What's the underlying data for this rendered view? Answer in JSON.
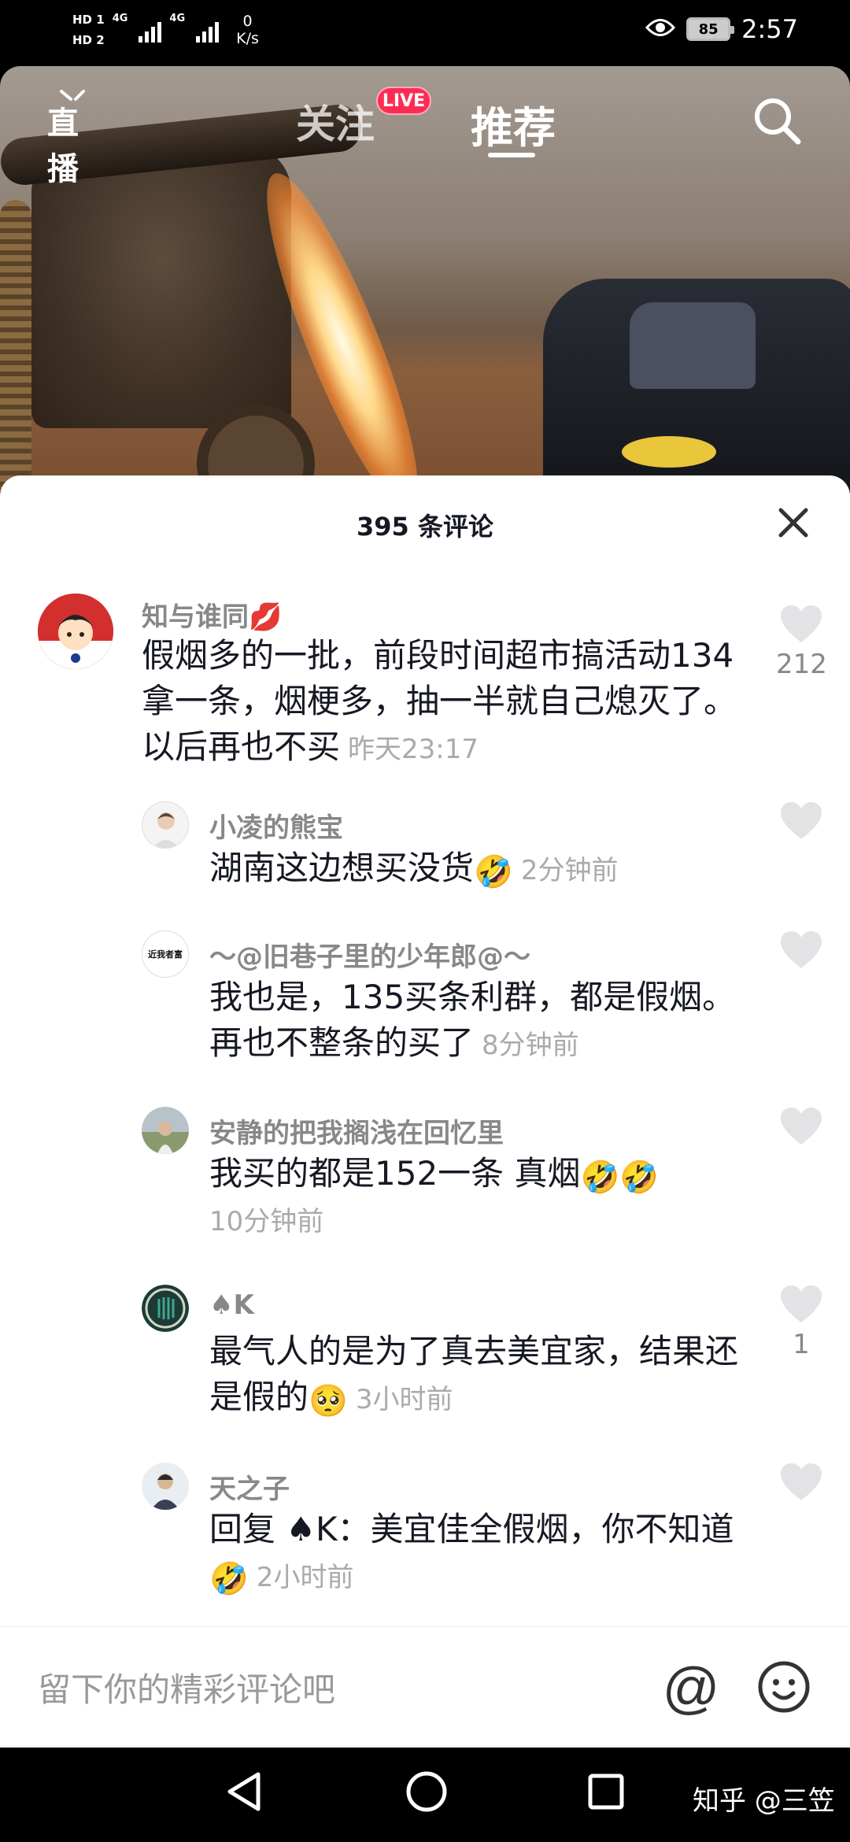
{
  "status_bar": {
    "hd_1": "HD",
    "hd_1_sub": "1",
    "hd_2": "HD",
    "hd_2_sub": "2",
    "net_1": "4G",
    "net_2": "4G",
    "speed_value": "0",
    "speed_unit": "K/s",
    "battery": "85",
    "time": "2:57"
  },
  "top_nav": {
    "live_label": "直播",
    "follow_label": "关注",
    "live_badge": "LIVE",
    "recommend_label": "推荐"
  },
  "sheet": {
    "title": "395 条评论"
  },
  "comments": [
    {
      "username": "知与谁同💋",
      "text": "假烟多的一批，前段时间超市搞活动134拿一条，烟梗多，抽一半就自己熄灭了。以后再也不买",
      "time": "昨天23:17",
      "likes": "212"
    },
    {
      "username": "小凌的熊宝",
      "text": "湖南这边想买没货",
      "emoji": "🤣",
      "time": "2分钟前",
      "likes": ""
    },
    {
      "username": "～@旧巷子里的少年郎@～",
      "avatar_text": "近我者富",
      "text": "我也是，135买条利群，都是假烟。再也不整条的买了",
      "time": "8分钟前",
      "likes": ""
    },
    {
      "username": "安静的把我搁浅在回忆里",
      "text": "我买的都是152一条 真烟",
      "emoji": "🤣🤣",
      "time": "10分钟前",
      "likes": ""
    },
    {
      "username": "♠K",
      "text": "最气人的是为了真去美宜家，结果还是假的",
      "emoji": "🥺",
      "time": "3小时前",
      "likes": "1"
    },
    {
      "username": "天之子",
      "text": "回复 ♠K：美宜佳全假烟，你不知道",
      "emoji": "🤣",
      "time": "2小时前",
      "likes": ""
    }
  ],
  "input": {
    "placeholder": "留下你的精彩评论吧",
    "at_symbol": "@"
  },
  "watermark": "知乎 @三笠",
  "colors": {
    "accent_live": "#fe2c55",
    "text_primary": "#161823",
    "text_secondary": "#888888"
  }
}
